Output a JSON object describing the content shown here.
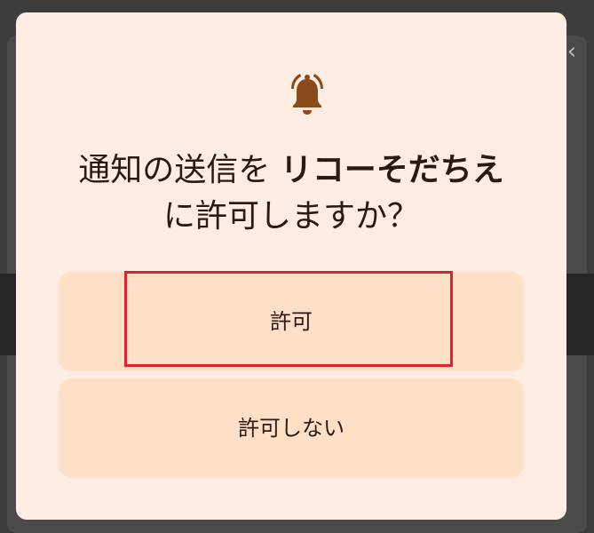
{
  "background": {
    "close_glyph": "‹"
  },
  "dialog": {
    "icon": "bell-icon",
    "title_prefix": "通知の送信を ",
    "app_name": "リコーそだちえ",
    "title_suffix": " に許可しますか？",
    "allow_label": "許可",
    "deny_label": "許可しない"
  },
  "colors": {
    "dialog_bg": "#ffede3",
    "button_bg": "#ffdfc6",
    "icon": "#8a4a1a",
    "highlight": "#e3202c"
  }
}
